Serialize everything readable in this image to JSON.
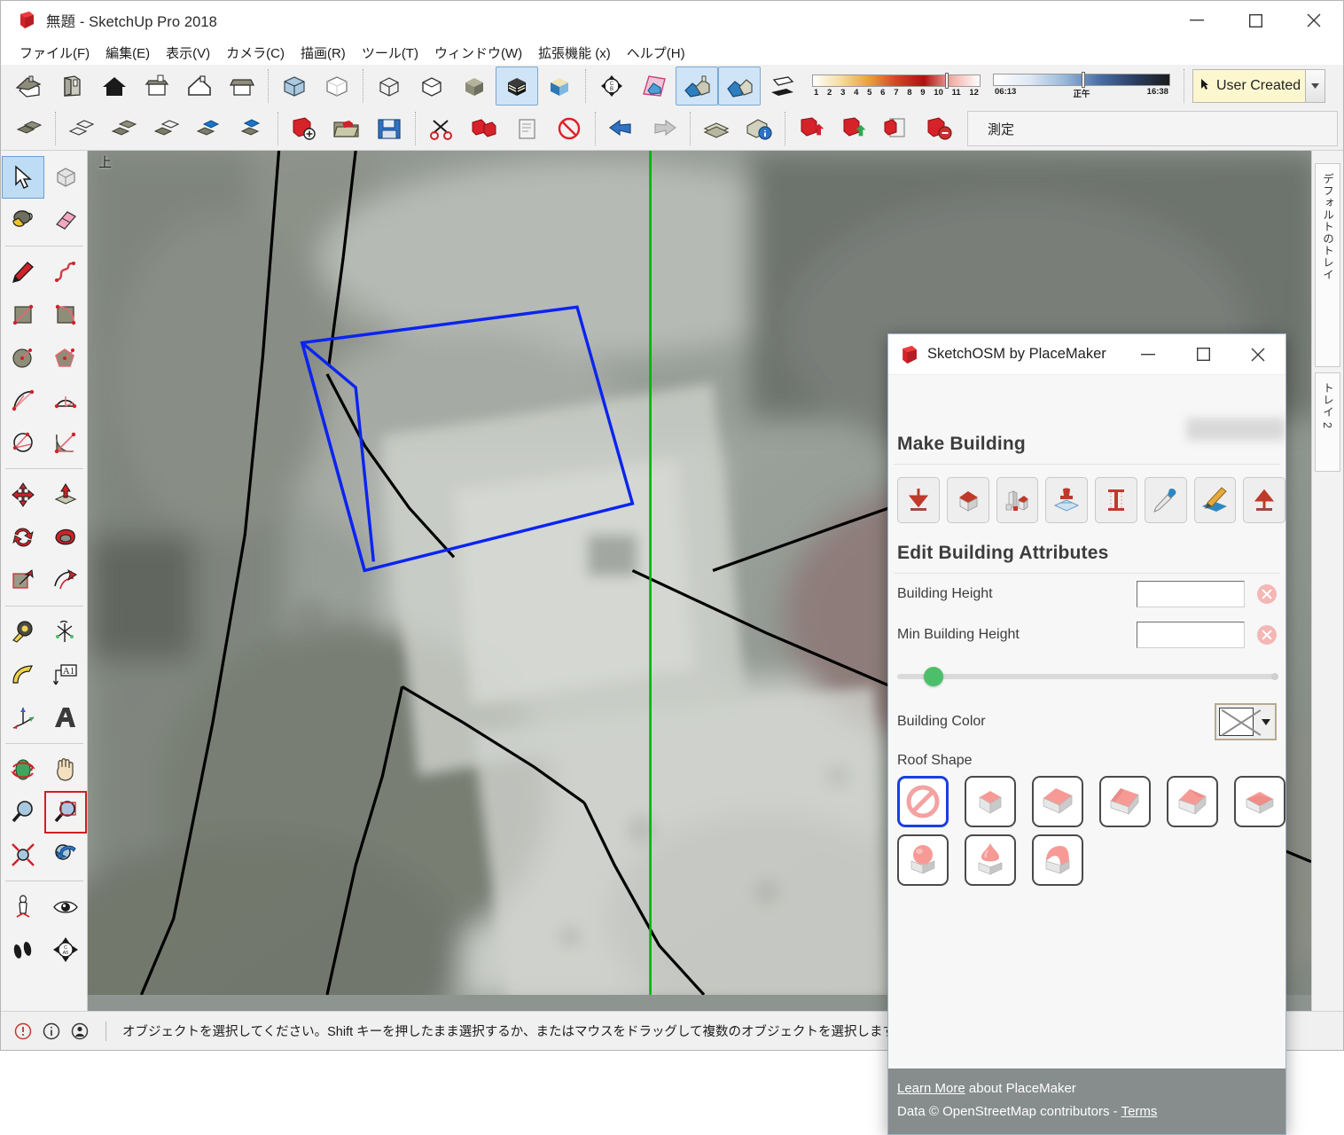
{
  "window": {
    "title": "無題 - SketchUp Pro 2018",
    "app_icon": "sketchup-logo-icon",
    "controls": {
      "minimize": "minimize-icon",
      "maximize": "maximize-icon",
      "close": "close-icon"
    }
  },
  "menubar": {
    "items": [
      {
        "label": "ファイル(F)",
        "name": "menu-file"
      },
      {
        "label": "編集(E)",
        "name": "menu-edit"
      },
      {
        "label": "表示(V)",
        "name": "menu-view"
      },
      {
        "label": "カメラ(C)",
        "name": "menu-camera"
      },
      {
        "label": "描画(R)",
        "name": "menu-draw"
      },
      {
        "label": "ツール(T)",
        "name": "menu-tools"
      },
      {
        "label": "ウィンドウ(W)",
        "name": "menu-window"
      },
      {
        "label": "拡張機能 (x)",
        "name": "menu-extensions"
      },
      {
        "label": "ヘルプ(H)",
        "name": "menu-help"
      }
    ]
  },
  "toolbar_row1": {
    "views": [
      "iso-view-icon",
      "top-view-icon",
      "front-view-icon",
      "right-view-icon",
      "back-view-icon",
      "left-view-icon"
    ],
    "styles": [
      "xray-style-icon",
      "back-edges-style-icon",
      "wireframe-style-icon",
      "hidden-line-style-icon",
      "shaded-style-icon",
      "shaded-with-textures-icon",
      "monochrome-style-icon"
    ],
    "shaded_with_textures_active": true,
    "location": [
      "position-camera-icon",
      "add-location-icon",
      "toggle-terrain-icon",
      "show-model-icon",
      "shadows-icon"
    ],
    "shadow_month": {
      "min": "1",
      "max": "12",
      "ticks": [
        "1",
        "2",
        "3",
        "4",
        "5",
        "6",
        "7",
        "8",
        "9",
        "10",
        "11",
        "12"
      ]
    },
    "shadow_time": {
      "start": "06:13",
      "noon": "正午",
      "end": "16:38"
    },
    "layer_combo": {
      "value": "User Created",
      "icon": "cursor-icon",
      "caret": "chevron-down-icon"
    }
  },
  "toolbar_row2": {
    "groups": [
      [
        "select-component-icon"
      ],
      [
        "wireframe-component-icon",
        "shaded-component-icon",
        "hidden-component-icon",
        "blue-component-icon",
        "blue-component-2-icon"
      ],
      [
        "add-model-icon",
        "open-folder-icon",
        "save-floppy-icon"
      ],
      [
        "scissors-icon",
        "split-icon",
        "document-icon",
        "cancel-icon"
      ],
      [
        "undo-arrow-icon",
        "redo-arrow-icon"
      ],
      [
        "layers-icon",
        "info-icon"
      ],
      [
        "export-icon",
        "import-icon",
        "report-icon",
        "purge-icon"
      ]
    ],
    "measurement": {
      "label": "測定",
      "value": ""
    }
  },
  "tool_palette": {
    "groups": [
      [
        {
          "name": "select-tool",
          "icon": "arrow-cursor-icon",
          "active": true
        },
        {
          "name": "make-component-tool",
          "icon": "component-box-icon",
          "active": false
        },
        {
          "name": "paint-bucket-tool",
          "icon": "paint-bucket-icon",
          "active": false
        },
        {
          "name": "eraser-tool",
          "icon": "eraser-icon",
          "active": false
        }
      ],
      [
        {
          "name": "line-tool",
          "icon": "pencil-icon",
          "active": false
        },
        {
          "name": "freehand-tool",
          "icon": "freehand-squiggle-icon",
          "active": false
        },
        {
          "name": "rectangle-tool",
          "icon": "rectangle-icon",
          "active": false
        },
        {
          "name": "rotated-rectangle-tool",
          "icon": "rotated-rectangle-icon",
          "active": false
        },
        {
          "name": "circle-tool",
          "icon": "circle-icon",
          "active": false
        },
        {
          "name": "polygon-tool",
          "icon": "polygon-icon",
          "active": false
        },
        {
          "name": "arc-tool",
          "icon": "arc-icon",
          "active": false
        },
        {
          "name": "two-point-arc-tool",
          "icon": "two-point-arc-icon",
          "active": false
        },
        {
          "name": "three-point-arc-tool",
          "icon": "three-point-arc-icon",
          "active": false
        },
        {
          "name": "pie-tool",
          "icon": "pie-icon",
          "active": false
        }
      ],
      [
        {
          "name": "move-tool",
          "icon": "move-arrows-icon",
          "active": false
        },
        {
          "name": "push-pull-tool",
          "icon": "push-pull-icon",
          "active": false
        },
        {
          "name": "rotate-tool",
          "icon": "rotate-icon",
          "active": false
        },
        {
          "name": "follow-me-tool",
          "icon": "follow-me-icon",
          "active": false
        },
        {
          "name": "scale-tool",
          "icon": "scale-icon",
          "active": false
        },
        {
          "name": "offset-tool",
          "icon": "offset-icon",
          "active": false
        }
      ],
      [
        {
          "name": "tape-measure-tool",
          "icon": "tape-measure-icon",
          "active": false
        },
        {
          "name": "protractor-axes-tool",
          "icon": "axes-protractor-icon",
          "active": false
        },
        {
          "name": "dimension-tool",
          "icon": "protractor-icon",
          "active": false
        },
        {
          "name": "text-tool",
          "icon": "text-label-icon",
          "active": false
        },
        {
          "name": "axes-tool",
          "icon": "axes-icon",
          "active": false
        },
        {
          "name": "3d-text-tool",
          "icon": "3d-text-icon",
          "active": false
        }
      ],
      [
        {
          "name": "orbit-tool",
          "icon": "orbit-icon",
          "active": false
        },
        {
          "name": "pan-tool",
          "icon": "hand-pan-icon",
          "active": false
        },
        {
          "name": "zoom-tool",
          "icon": "magnifier-icon",
          "active": false
        },
        {
          "name": "zoom-window-tool",
          "icon": "zoom-window-icon",
          "active": false,
          "framed": true
        },
        {
          "name": "zoom-extents-tool",
          "icon": "zoom-extents-icon",
          "active": false
        },
        {
          "name": "previous-view-tool",
          "icon": "previous-view-icon",
          "active": false
        }
      ],
      [
        {
          "name": "position-camera-tool",
          "icon": "person-camera-icon",
          "active": false
        },
        {
          "name": "look-around-tool",
          "icon": "eye-icon",
          "active": false
        },
        {
          "name": "walk-tool",
          "icon": "footprints-icon",
          "active": false
        },
        {
          "name": "section-plane-tool",
          "icon": "section-plane-icon",
          "active": false
        }
      ]
    ]
  },
  "viewport": {
    "view_label": "上",
    "axis_color": "#00b200",
    "selection_color": "#0b24f0"
  },
  "trays": [
    {
      "label": "デフォルトのトレイ",
      "name": "tray-tab-default"
    },
    {
      "label": "トレイ 2",
      "name": "tray-tab-2"
    }
  ],
  "statusbar": {
    "icons": [
      "warning-icon",
      "info-icon",
      "person-icon"
    ],
    "message": "オブジェクトを選択してください。Shift キーを押したまま選択するか、またはマウスをドラッグして複数のオブジェクトを選択します。"
  },
  "osm_dialog": {
    "title": "SketchOSM by PlaceMaker",
    "icon": "sketchup-logo-icon",
    "controls": {
      "minimize": "minimize-icon",
      "maximize": "maximize-icon",
      "close": "close-icon"
    },
    "make_building": {
      "heading": "Make Building",
      "tools": [
        {
          "name": "make-building-down-arrow-tool",
          "icon": "down-arrow-icon"
        },
        {
          "name": "make-building-house-tool",
          "icon": "house-icon"
        },
        {
          "name": "make-building-multi-tool",
          "icon": "multi-building-icon"
        },
        {
          "name": "make-building-stamp-tool",
          "icon": "stamp-icon"
        },
        {
          "name": "make-building-height-tool",
          "icon": "height-gauge-icon"
        },
        {
          "name": "make-building-eyedropper-tool",
          "icon": "eyedropper-icon"
        },
        {
          "name": "make-building-edit-tool",
          "icon": "pencil-edit-icon"
        },
        {
          "name": "make-building-up-arrow-tool",
          "icon": "up-arrow-icon"
        }
      ]
    },
    "edit_attributes": {
      "heading": "Edit Building Attributes",
      "building_height": {
        "label": "Building Height",
        "value": "",
        "placeholder": "",
        "clear": "clear-icon"
      },
      "min_building_height": {
        "label": "Min Building Height",
        "value": "",
        "placeholder": "",
        "clear": "clear-icon"
      },
      "slider": {
        "value": 2,
        "min": 0,
        "max": 100,
        "handle_color": "#4cbf6a"
      },
      "building_color": {
        "label": "Building Color",
        "swatch": "none-swatch-icon",
        "caret": "chevron-down-icon"
      },
      "roof_shape": {
        "label": "Roof Shape",
        "options": [
          {
            "name": "roof-shape-none",
            "icon": "no-roof-icon",
            "selected": true
          },
          {
            "name": "roof-shape-flat",
            "icon": "flat-roof-icon",
            "selected": false
          },
          {
            "name": "roof-shape-skillion",
            "icon": "skillion-roof-icon",
            "selected": false
          },
          {
            "name": "roof-shape-gabled",
            "icon": "gabled-roof-icon",
            "selected": false
          },
          {
            "name": "roof-shape-hipped",
            "icon": "hipped-roof-icon",
            "selected": false
          },
          {
            "name": "roof-shape-pyramidal",
            "icon": "pyramidal-roof-icon",
            "selected": false
          },
          {
            "name": "roof-shape-dome",
            "icon": "dome-roof-icon",
            "selected": false
          },
          {
            "name": "roof-shape-onion",
            "icon": "onion-roof-icon",
            "selected": false
          },
          {
            "name": "roof-shape-round",
            "icon": "round-roof-icon",
            "selected": false
          }
        ]
      }
    },
    "footer": {
      "learn_more": "Learn More",
      "learn_more_suffix": " about PlaceMaker",
      "data_prefix": "Data © OpenStreetMap contributors - ",
      "terms": "Terms"
    }
  }
}
